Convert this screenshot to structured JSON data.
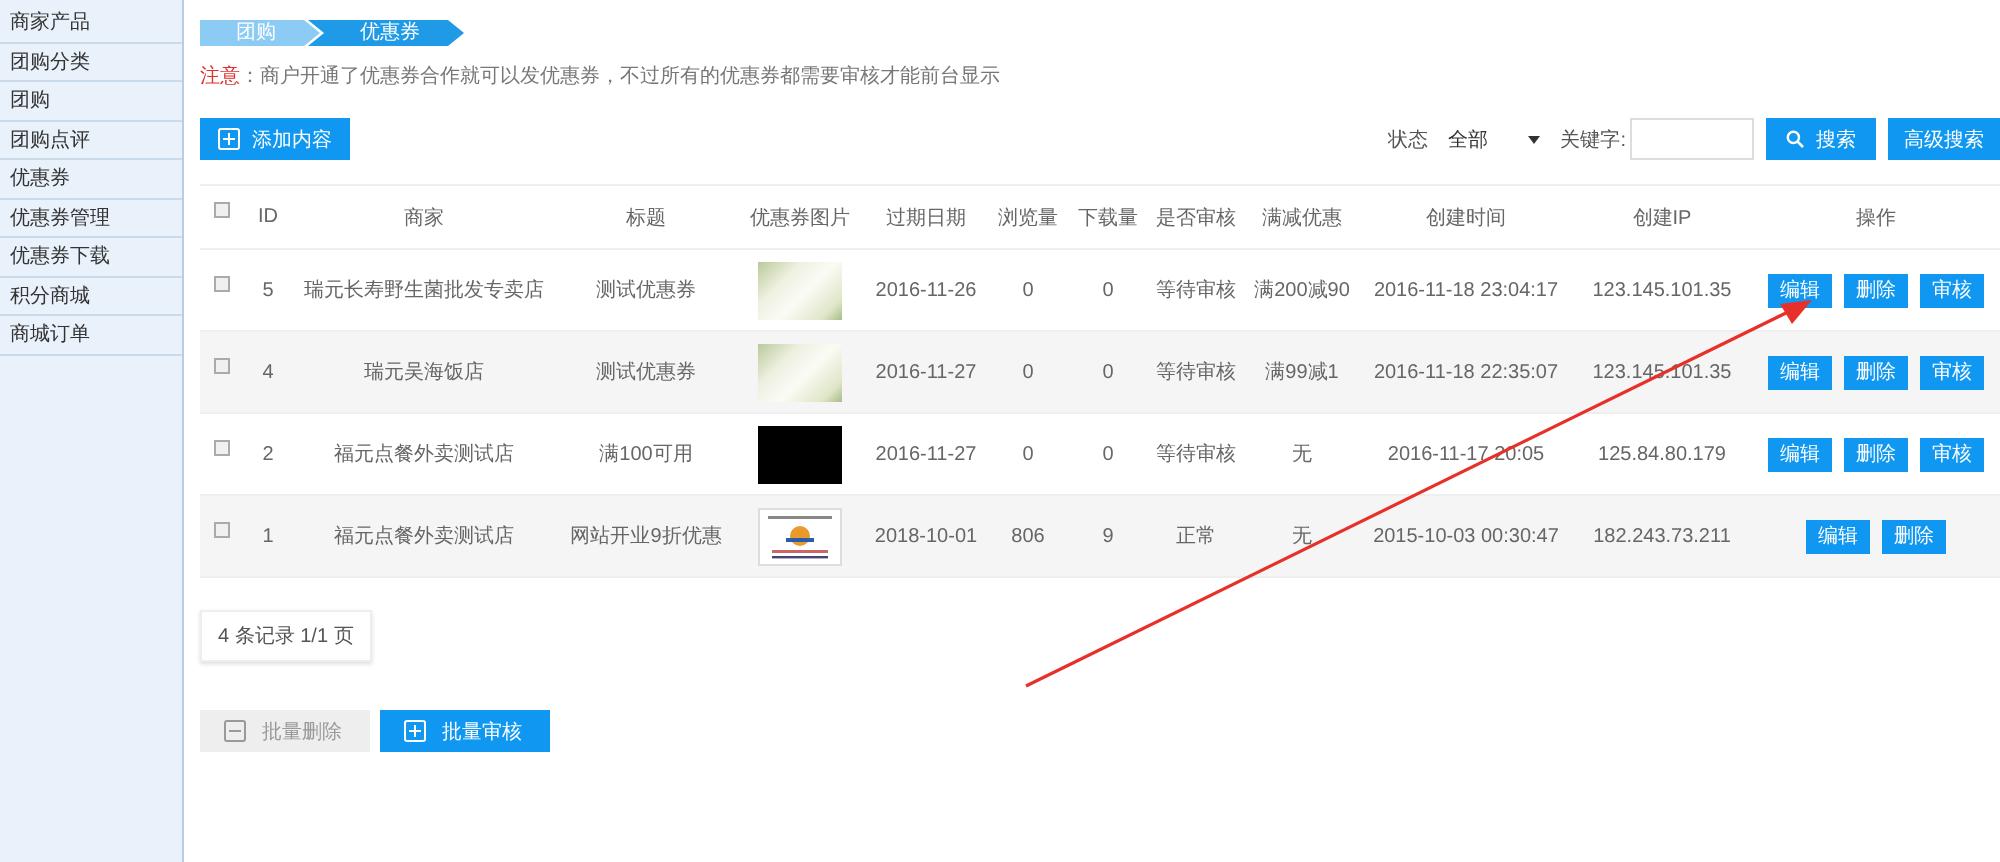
{
  "sidebar": {
    "items": [
      {
        "label": "商家产品"
      },
      {
        "label": "团购分类"
      },
      {
        "label": "团购"
      },
      {
        "label": "团购点评"
      },
      {
        "label": "优惠券"
      },
      {
        "label": "优惠券管理"
      },
      {
        "label": "优惠券下载"
      },
      {
        "label": "积分商城"
      },
      {
        "label": "商城订单"
      }
    ]
  },
  "breadcrumb": [
    {
      "label": "团购",
      "selected": false
    },
    {
      "label": "优惠券",
      "selected": true
    }
  ],
  "notice": {
    "label": "注意",
    "text": "：商户开通了优惠券合作就可以发优惠券，不过所有的优惠券都需要审核才能前台显示"
  },
  "add_button": "添加内容",
  "filter": {
    "status_label": "状态",
    "status_value": "全部",
    "keyword_label": "关键字:",
    "search_button": "搜索",
    "advanced_button": "高级搜索"
  },
  "table": {
    "header_checked": false,
    "columns": [
      "ID",
      "商家",
      "标题",
      "优惠券图片",
      "过期日期",
      "浏览量",
      "下载量",
      "是否审核",
      "满减优惠",
      "创建时间",
      "创建IP",
      "操作"
    ],
    "rows": [
      {
        "checked": false,
        "id": "5",
        "merchant": "瑞元长寿野生菌批发专卖店",
        "title": "测试优惠券",
        "image": {
          "kind": "photo"
        },
        "expires": "2016-11-26",
        "views": "0",
        "downloads": "0",
        "review": "等待审核",
        "discount": "满200减90",
        "created": "2016-11-18 23:04:17",
        "ip": "123.145.101.35",
        "actions": [
          "编辑",
          "删除",
          "审核"
        ]
      },
      {
        "checked": false,
        "id": "4",
        "merchant": "瑞元吴海饭店",
        "title": "测试优惠券",
        "image": {
          "kind": "photo"
        },
        "expires": "2016-11-27",
        "views": "0",
        "downloads": "0",
        "review": "等待审核",
        "discount": "满99减1",
        "created": "2016-11-18 22:35:07",
        "ip": "123.145.101.35",
        "actions": [
          "编辑",
          "删除",
          "审核"
        ]
      },
      {
        "checked": false,
        "id": "2",
        "merchant": "福元点餐外卖测试店",
        "title": "满100可用",
        "image": {
          "kind": "dark"
        },
        "expires": "2016-11-27",
        "views": "0",
        "downloads": "0",
        "review": "等待审核",
        "discount": "无",
        "created": "2016-11-17 20:05",
        "ip": "125.84.80.179",
        "actions": [
          "编辑",
          "删除",
          "审核"
        ]
      },
      {
        "checked": false,
        "id": "1",
        "merchant": "福元点餐外卖测试店",
        "title": "网站开业9折优惠",
        "image": {
          "kind": "logo"
        },
        "expires": "2018-10-01",
        "views": "806",
        "downloads": "9",
        "review": "正常",
        "discount": "无",
        "created": "2015-10-03 00:30:47",
        "ip": "182.243.73.211",
        "actions": [
          "编辑",
          "删除"
        ]
      }
    ]
  },
  "pagination": "4 条记录 1/1 页",
  "bulk_buttons": [
    {
      "label": "批量删除",
      "kind": "minus"
    },
    {
      "label": "批量审核",
      "kind": "plus"
    }
  ]
}
